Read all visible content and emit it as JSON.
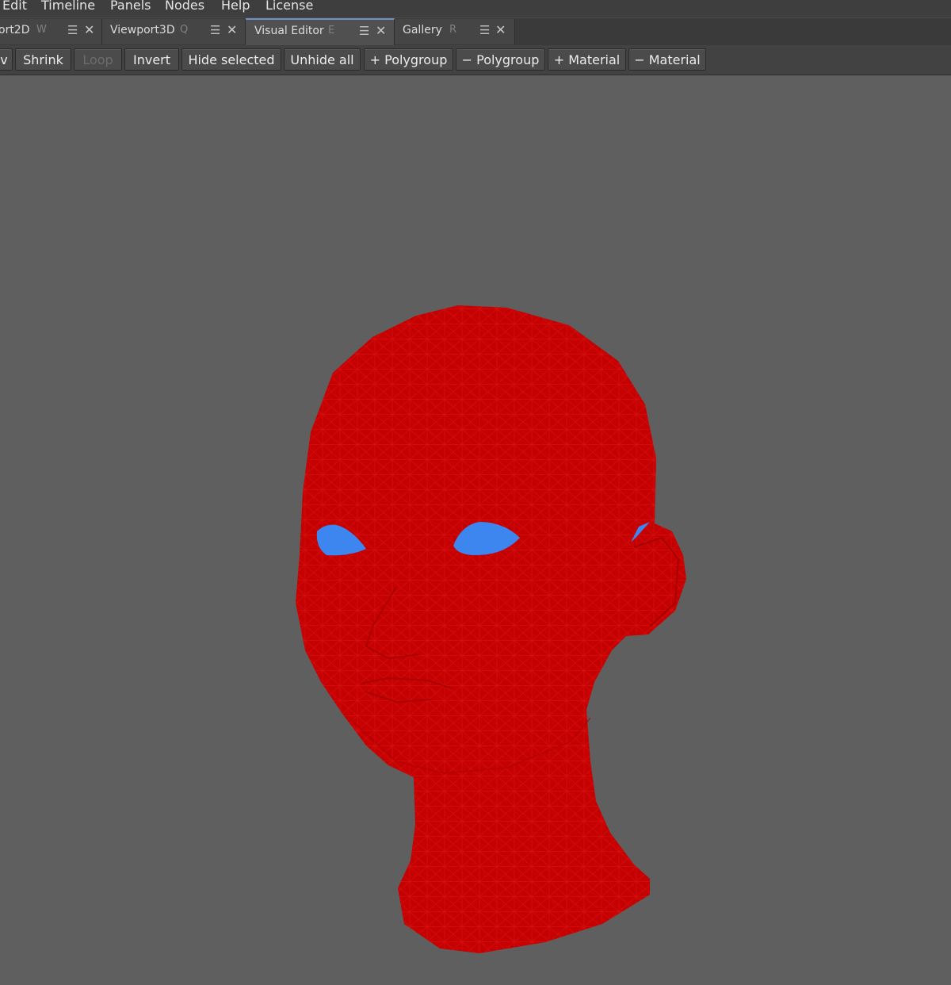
{
  "menubar": {
    "items": [
      "Edit",
      "Timeline",
      "Panels",
      "Nodes",
      "Help",
      "License"
    ]
  },
  "tabs": [
    {
      "label": "ort2D",
      "key": "W"
    },
    {
      "label": "Viewport3D",
      "key": "Q"
    },
    {
      "label": "Visual Editor",
      "key": "E"
    },
    {
      "label": "Gallery",
      "key": "R"
    }
  ],
  "tab_icons": {
    "menu": "☰",
    "close": "✕"
  },
  "toolbar": {
    "cut_label": "v",
    "buttons": [
      "Shrink",
      "Loop",
      "Invert",
      "Hide selected",
      "Unhide all",
      "+ Polygroup",
      "− Polygroup",
      "+ Material",
      "− Material"
    ]
  },
  "colors": {
    "background": "#5f5f5f",
    "mesh": "#c40000",
    "wire": "#e31b1b",
    "eyes": "#3d86ef",
    "active_tab_accent": "#6e8fc4"
  }
}
